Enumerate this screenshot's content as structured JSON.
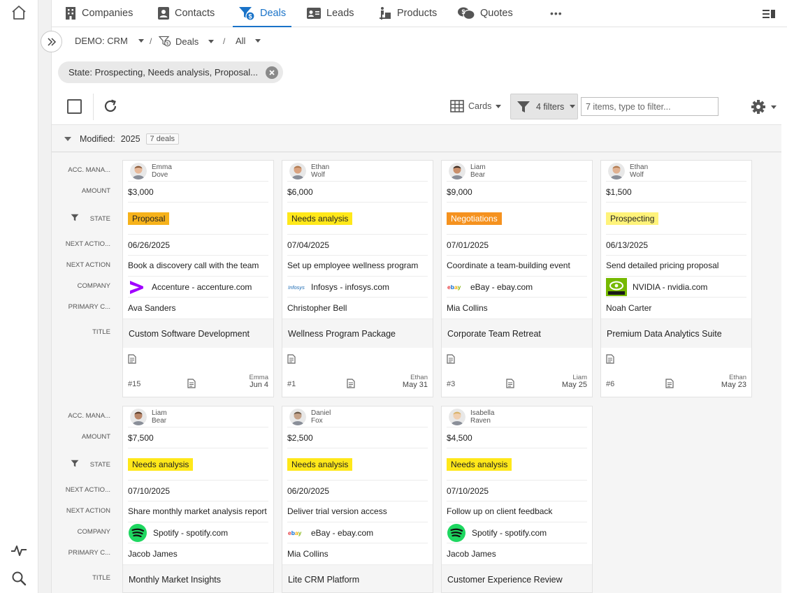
{
  "nav": {
    "tabs": [
      {
        "label": "Companies",
        "active": false
      },
      {
        "label": "Contacts",
        "active": false
      },
      {
        "label": "Deals",
        "active": true
      },
      {
        "label": "Leads",
        "active": false
      },
      {
        "label": "Products",
        "active": false
      },
      {
        "label": "Quotes",
        "active": false
      }
    ],
    "more": "•••"
  },
  "breadcrumb": {
    "workspace": "DEMO: CRM",
    "module": "Deals",
    "view": "All",
    "separator": "/"
  },
  "filter_chip": {
    "label": "State: Prospecting, Needs analysis, Proposal..."
  },
  "toolbar": {
    "view_label": "Cards",
    "filters_label": "4 filters",
    "filter_placeholder": "7 items, type to filter..."
  },
  "group": {
    "label": "Modified:",
    "value": "2025",
    "count": "7 deals"
  },
  "field_labels": {
    "manager": "ACC. MANA...",
    "amount": "AMOUNT",
    "state": "STATE",
    "next_date": "NEXT ACTIO...",
    "next_action": "NEXT ACTION",
    "company": "COMPANY",
    "contact": "PRIMARY C...",
    "title": "TITLE"
  },
  "colors": {
    "accent": "#1a73c8",
    "Proposal": "#f6b21b",
    "Needs analysis": "#ffe81a",
    "Negotiations": "#f5921f",
    "Prospecting": "#fff37a"
  },
  "cards": [
    {
      "mgr_first": "Emma",
      "mgr_last": "Dove",
      "amount": "$3,000",
      "state": "Proposal",
      "next_date": "06/26/2025",
      "next_action": "Book a discovery call with the team",
      "company": "Accenture - accenture.com",
      "logo": "accenture-logo",
      "contact": "Ava Sanders",
      "title": "Custom Software Development",
      "num": "#15",
      "mod_by": "Emma",
      "mod_date": "Jun 4"
    },
    {
      "mgr_first": "Ethan",
      "mgr_last": "Wolf",
      "amount": "$6,000",
      "state": "Needs analysis",
      "next_date": "07/04/2025",
      "next_action": "Set up employee wellness program",
      "company": "Infosys - infosys.com",
      "logo": "infosys-logo",
      "contact": "Christopher Bell",
      "title": "Wellness Program Package",
      "num": "#1",
      "mod_by": "Ethan",
      "mod_date": "May 31"
    },
    {
      "mgr_first": "Liam",
      "mgr_last": "Bear",
      "amount": "$9,000",
      "state": "Negotiations",
      "next_date": "07/01/2025",
      "next_action": "Coordinate a team-building event",
      "company": "eBay - ebay.com",
      "logo": "ebay-logo",
      "contact": "Mia Collins",
      "title": "Corporate Team Retreat",
      "num": "#3",
      "mod_by": "Liam",
      "mod_date": "May 25"
    },
    {
      "mgr_first": "Ethan",
      "mgr_last": "Wolf",
      "amount": "$1,500",
      "state": "Prospecting",
      "next_date": "06/13/2025",
      "next_action": "Send detailed pricing proposal",
      "company": "NVIDIA - nvidia.com",
      "logo": "nvidia-logo",
      "contact": "Noah Carter",
      "title": "Premium Data Analytics Suite",
      "num": "#6",
      "mod_by": "Ethan",
      "mod_date": "May 23"
    },
    {
      "mgr_first": "Liam",
      "mgr_last": "Bear",
      "amount": "$7,500",
      "state": "Needs analysis",
      "next_date": "07/10/2025",
      "next_action": "Share monthly market analysis report",
      "company": "Spotify - spotify.com",
      "logo": "spotify-logo",
      "contact": "Jacob James",
      "title": "Monthly Market Insights"
    },
    {
      "mgr_first": "Daniel",
      "mgr_last": "Fox",
      "amount": "$2,500",
      "state": "Needs analysis",
      "next_date": "06/20/2025",
      "next_action": "Deliver trial version access",
      "company": "eBay - ebay.com",
      "logo": "ebay-logo",
      "contact": "Mia Collins",
      "title": "Lite CRM Platform"
    },
    {
      "mgr_first": "Isabella",
      "mgr_last": "Raven",
      "amount": "$4,500",
      "state": "Needs analysis",
      "next_date": "07/10/2025",
      "next_action": "Follow up on client feedback",
      "company": "Spotify - spotify.com",
      "logo": "spotify-logo",
      "contact": "Jacob James",
      "title": "Customer Experience Review"
    }
  ]
}
